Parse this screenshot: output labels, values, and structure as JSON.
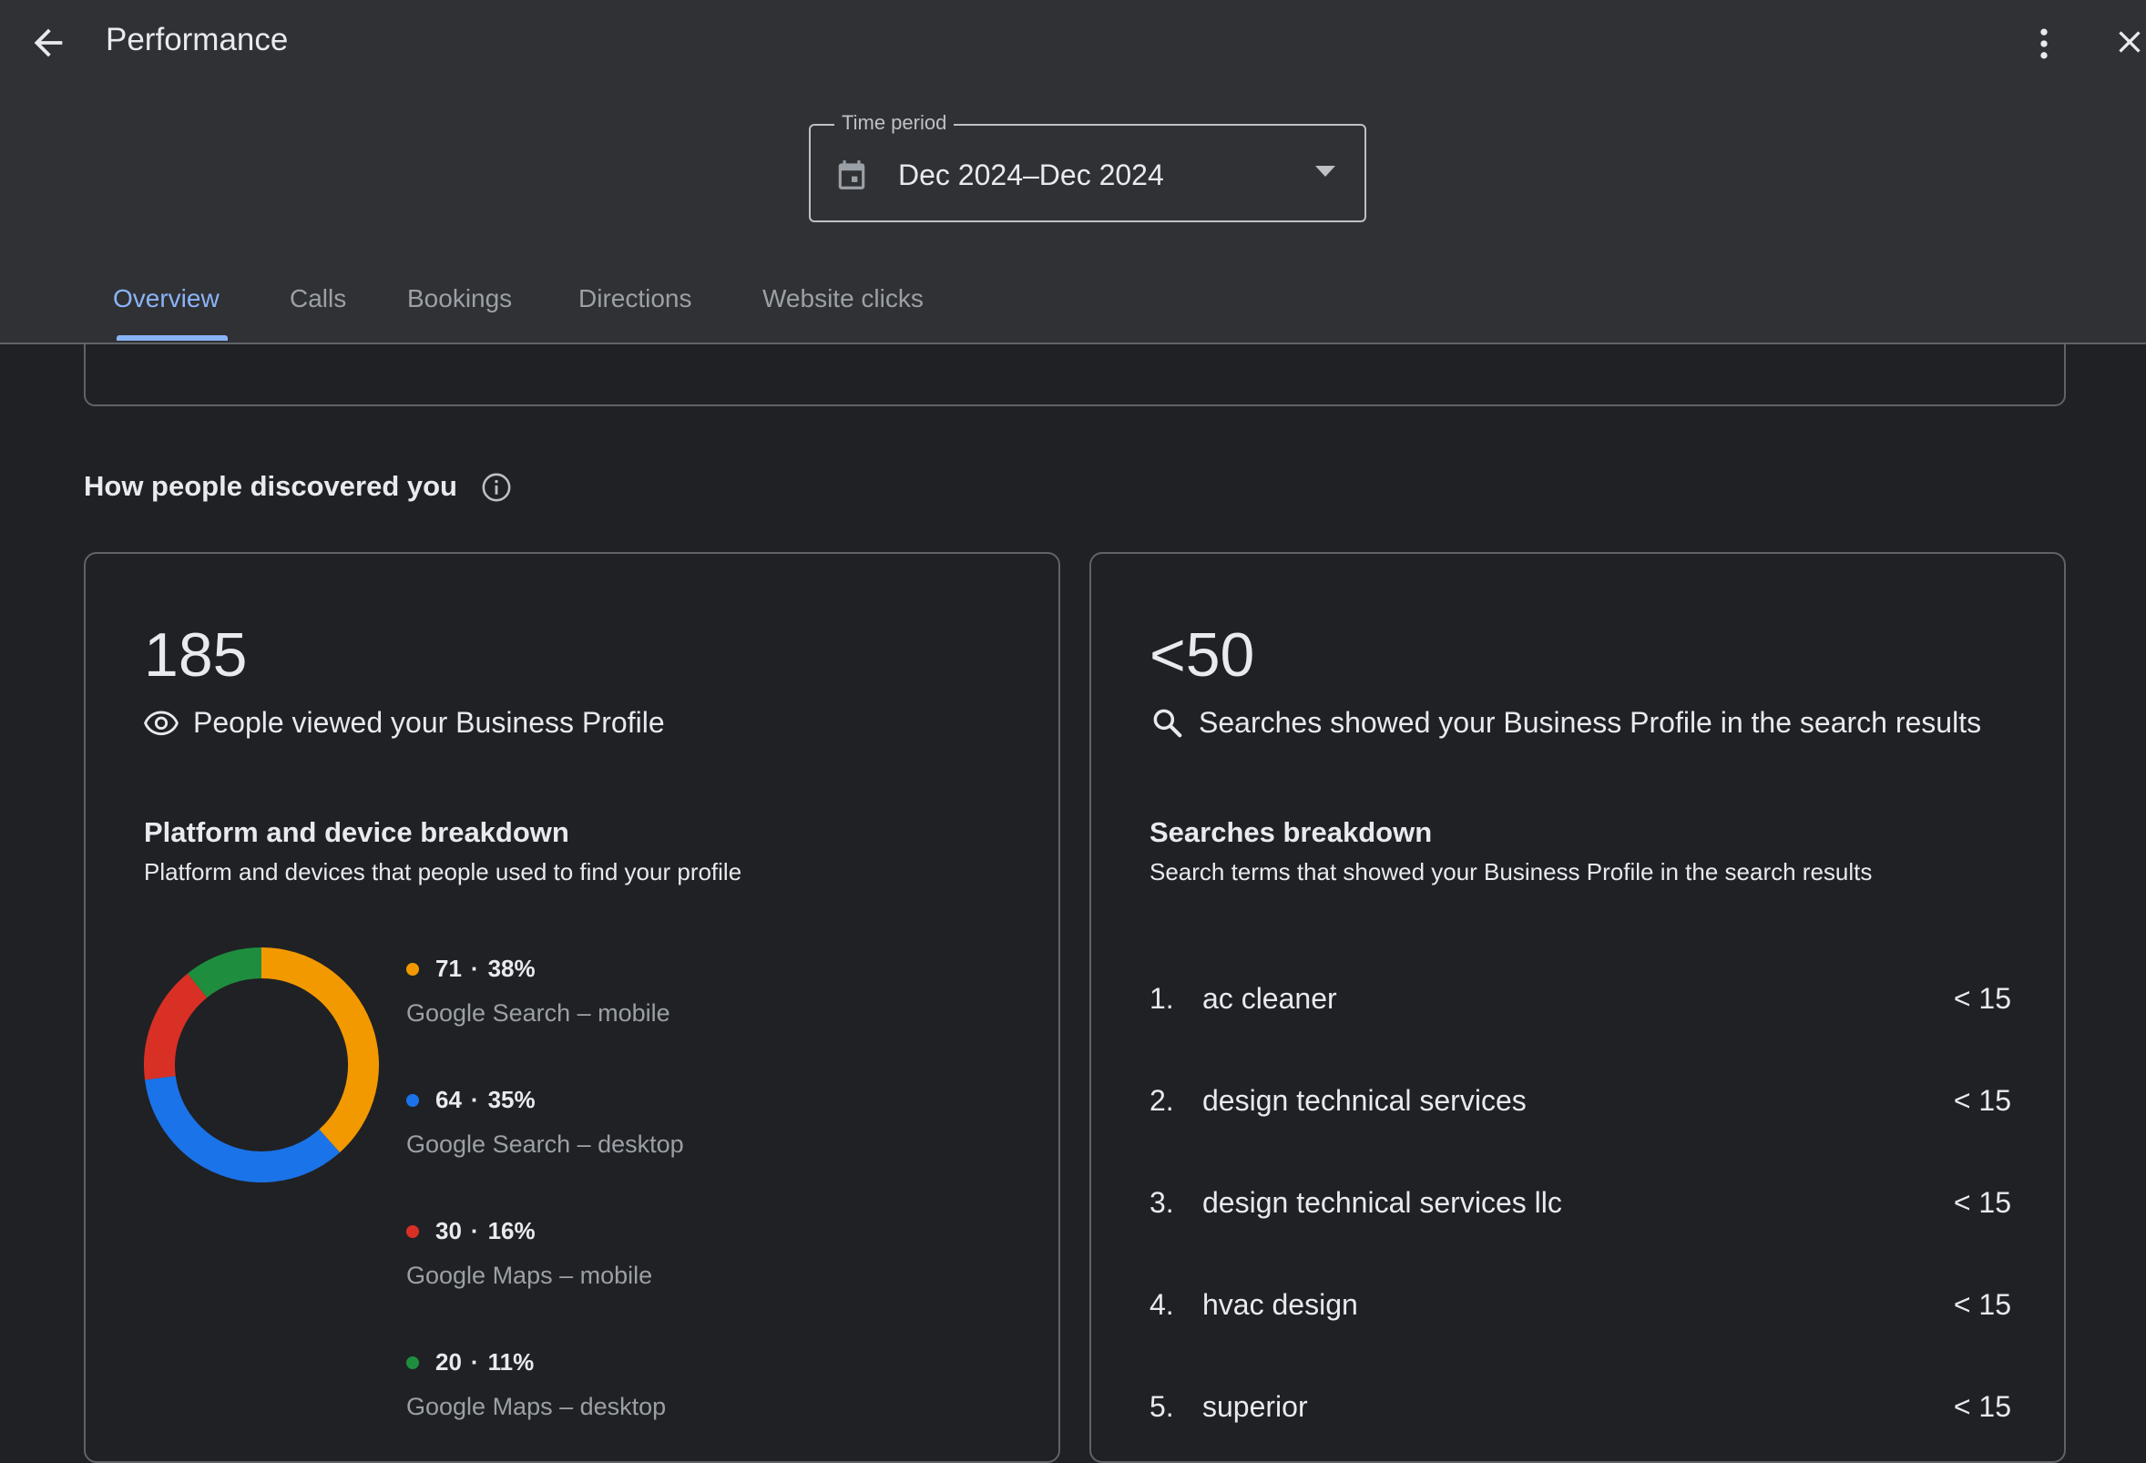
{
  "header": {
    "title": "Performance",
    "back_icon": "arrow-back-icon",
    "more_icon": "more-vert-icon",
    "close_icon": "close-icon"
  },
  "time_period": {
    "label": "Time period",
    "value": "Dec 2024–Dec 2024"
  },
  "tabs": [
    {
      "label": "Overview",
      "active": true
    },
    {
      "label": "Calls",
      "active": false
    },
    {
      "label": "Bookings",
      "active": false
    },
    {
      "label": "Directions",
      "active": false
    },
    {
      "label": "Website clicks",
      "active": false
    }
  ],
  "section": {
    "title": "How people discovered you"
  },
  "profile_views": {
    "value": "185",
    "label": "People viewed your Business Profile",
    "breakdown_title": "Platform and device breakdown",
    "breakdown_desc": "Platform and devices that people used to find your profile",
    "items": [
      {
        "count": "71",
        "percent": "38%",
        "label": "Google Search – mobile",
        "color": "#f29900",
        "value": 71
      },
      {
        "count": "64",
        "percent": "35%",
        "label": "Google Search – desktop",
        "color": "#1a73e8",
        "value": 64
      },
      {
        "count": "30",
        "percent": "16%",
        "label": "Google Maps – mobile",
        "color": "#d93025",
        "value": 30
      },
      {
        "count": "20",
        "percent": "11%",
        "label": "Google Maps – desktop",
        "color": "#1e8e3e",
        "value": 20
      }
    ]
  },
  "searches": {
    "value": "<50",
    "label": "Searches showed your Business Profile in the search results",
    "breakdown_title": "Searches breakdown",
    "breakdown_desc": "Search terms that showed your Business Profile in the search results",
    "items": [
      {
        "rank": "1.",
        "term": "ac cleaner",
        "count": "< 15"
      },
      {
        "rank": "2.",
        "term": "design technical services",
        "count": "< 15"
      },
      {
        "rank": "3.",
        "term": "design technical services llc",
        "count": "< 15"
      },
      {
        "rank": "4.",
        "term": "hvac design",
        "count": "< 15"
      },
      {
        "rank": "5.",
        "term": "superior",
        "count": "< 15"
      }
    ]
  }
}
